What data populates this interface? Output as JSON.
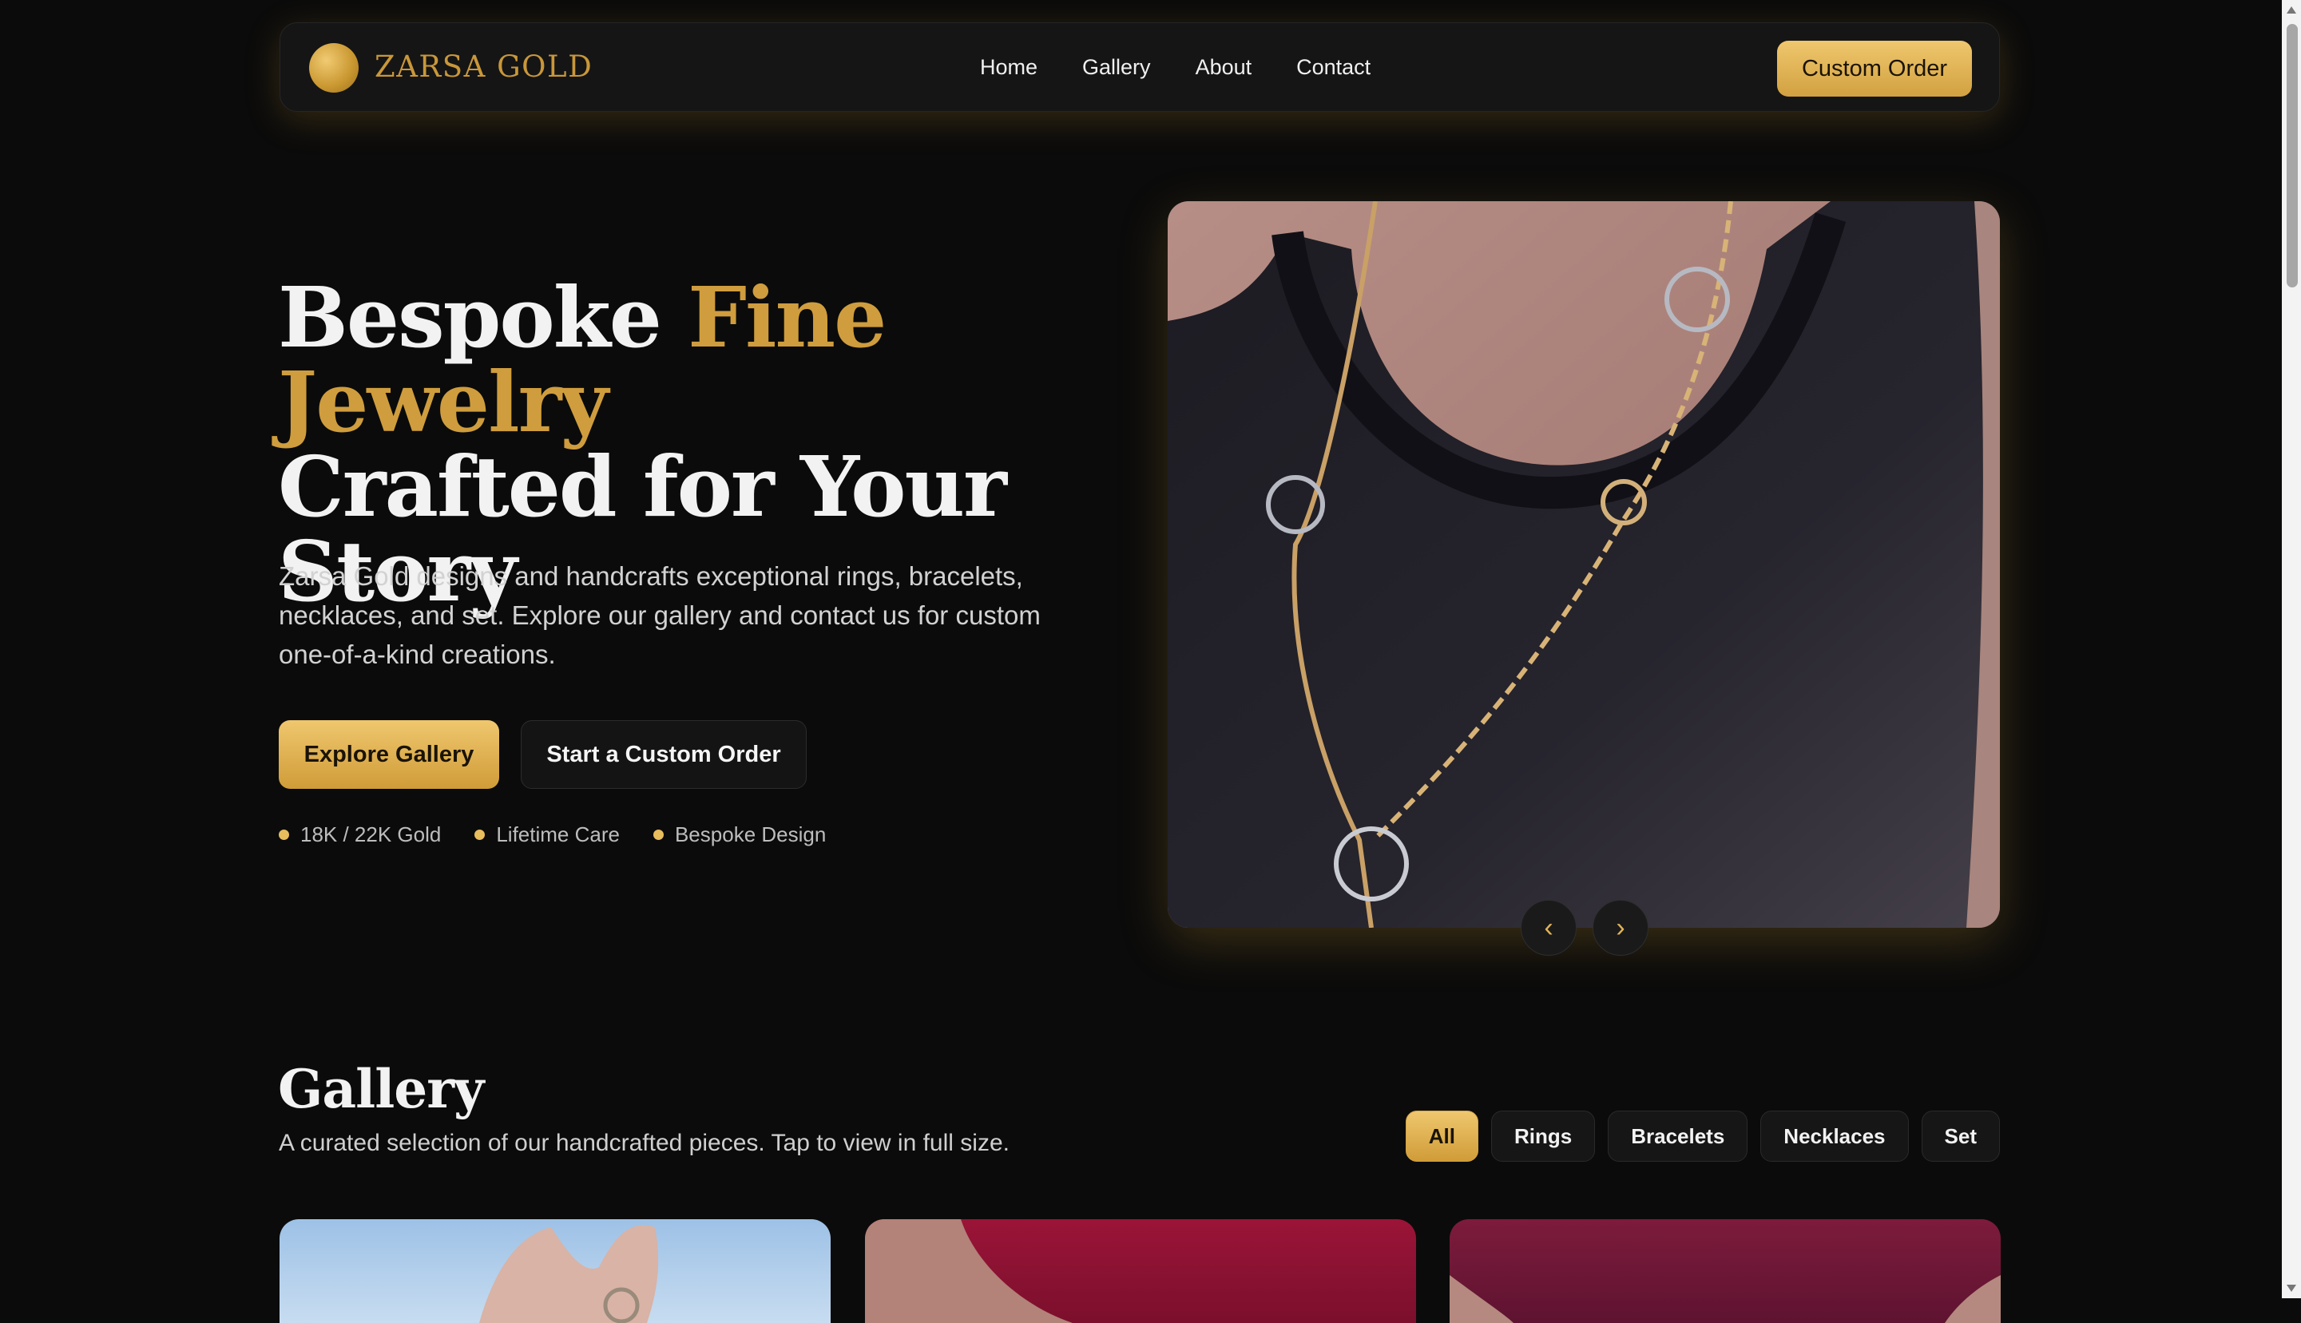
{
  "nav": {
    "logo_text": "ZARSA GOLD",
    "links": [
      "Home",
      "Gallery",
      "About",
      "Contact"
    ],
    "cta": "Custom Order"
  },
  "hero": {
    "title_part1": "Bespoke ",
    "title_gold": "Fine Jewelry",
    "title_part2": "Crafted for Your Story",
    "subtitle": "Zarsa Gold designs and handcrafts exceptional rings, bracelets, necklaces, and set. Explore our gallery and contact us for custom one-of-a-kind creations.",
    "primary_button": "Explore Gallery",
    "secondary_button": "Start a Custom Order",
    "badges": [
      "18K / 22K Gold",
      "Lifetime Care",
      "Bespoke Design"
    ],
    "carousel_prev": "‹",
    "carousel_next": "›"
  },
  "gallery": {
    "title": "Gallery",
    "subtitle": "A curated selection of our handcrafted pieces. Tap to view in full size.",
    "filters": [
      "All",
      "Rings",
      "Bracelets",
      "Necklaces",
      "Set"
    ],
    "active_filter": "All"
  },
  "colors": {
    "gold": "#cf9d3d",
    "gold_light": "#efc76e",
    "background": "#0b0b0b",
    "surface": "#151515"
  }
}
